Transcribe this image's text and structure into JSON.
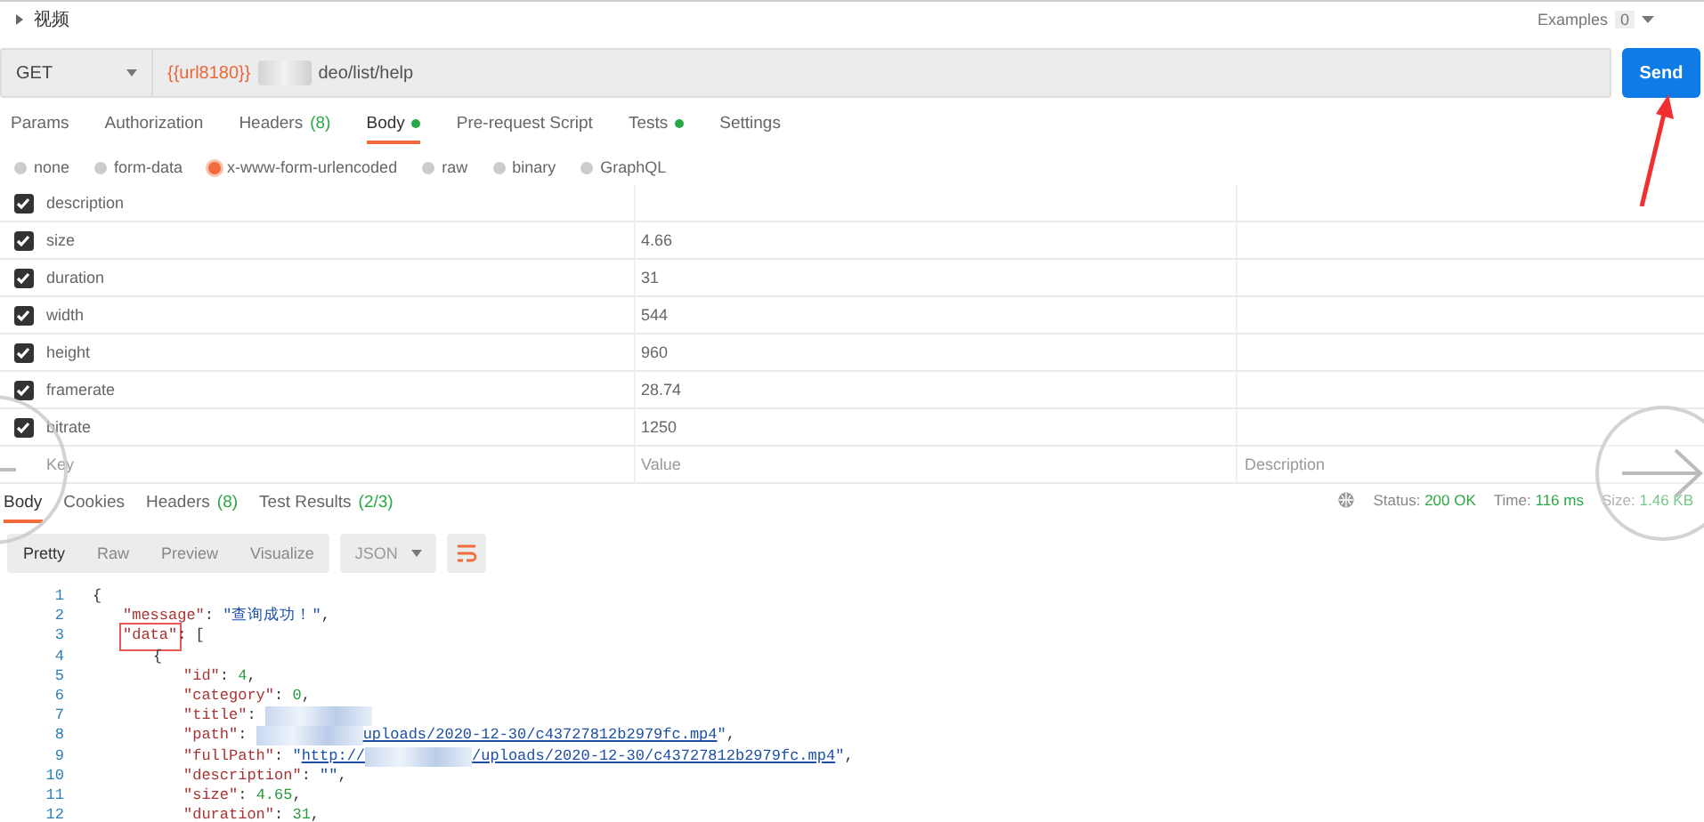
{
  "collection": {
    "label": "视频",
    "expanded": false
  },
  "examples": {
    "label": "Examples",
    "count": "0"
  },
  "request": {
    "method": "GET",
    "url_variable": "{{url8180}}",
    "url_path": "deo/list/help"
  },
  "send_button": "Send",
  "request_tabs": [
    {
      "label": "Params",
      "selected": false,
      "dot": false
    },
    {
      "label": "Authorization",
      "selected": false,
      "dot": false
    },
    {
      "label": "Headers",
      "count": "(8)",
      "selected": false,
      "dot": false
    },
    {
      "label": "Body",
      "selected": true,
      "dot": true
    },
    {
      "label": "Pre-request Script",
      "selected": false,
      "dot": false
    },
    {
      "label": "Tests",
      "selected": false,
      "dot": true
    },
    {
      "label": "Settings",
      "selected": false,
      "dot": false
    }
  ],
  "body_types": [
    {
      "label": "none",
      "selected": false
    },
    {
      "label": "form-data",
      "selected": false
    },
    {
      "label": "x-www-form-urlencoded",
      "selected": true
    },
    {
      "label": "raw",
      "selected": false
    },
    {
      "label": "binary",
      "selected": false
    },
    {
      "label": "GraphQL",
      "selected": false
    }
  ],
  "params": {
    "rows": [
      {
        "checked": true,
        "key": "description"
      },
      {
        "checked": true,
        "key": "size",
        "value": "4.66"
      },
      {
        "checked": true,
        "key": "duration",
        "value": "31"
      },
      {
        "checked": true,
        "key": "width",
        "value": "544"
      },
      {
        "checked": true,
        "key": "height",
        "value": "960"
      },
      {
        "checked": true,
        "key": "framerate",
        "value": "28.74"
      },
      {
        "checked": true,
        "key": "bitrate",
        "value": "1250"
      }
    ],
    "placeholders": {
      "key": "Key",
      "value": "Value",
      "description": "Description"
    }
  },
  "response_tabs": [
    {
      "label": "Body",
      "selected": true
    },
    {
      "label": "Cookies",
      "selected": false
    },
    {
      "label": "Headers",
      "count": "(8)",
      "selected": false
    },
    {
      "label": "Test Results",
      "count": "(2/3)",
      "selected": false
    }
  ],
  "response_meta": {
    "status_label": "Status:",
    "status": "200 OK",
    "time_label": "Time:",
    "time": "116 ms",
    "size_label": "Size:",
    "size": "1.46 KB"
  },
  "view_modes": [
    {
      "label": "Pretty",
      "selected": true
    },
    {
      "label": "Raw",
      "selected": false
    },
    {
      "label": "Preview",
      "selected": false
    },
    {
      "label": "Visualize",
      "selected": false
    }
  ],
  "format": "JSON",
  "code_lines": [
    {
      "number": "1",
      "tokens": [
        {
          "kind": "punct",
          "text": "{"
        }
      ]
    },
    {
      "number": "2",
      "tokens": [
        {
          "kind": "key",
          "text": "\"message\"",
          "boxed": false
        },
        {
          "kind": "punct",
          "text": ": "
        },
        {
          "kind": "string",
          "text": "\"查询成功！\""
        },
        {
          "kind": "punct",
          "text": ","
        }
      ]
    },
    {
      "number": "3",
      "tokens": [
        {
          "kind": "key",
          "text": "\"data\"",
          "boxed": true
        },
        {
          "kind": "punct",
          "text": ": ["
        }
      ]
    },
    {
      "number": "4",
      "tokens": [
        {
          "kind": "punct",
          "text": "{"
        }
      ]
    },
    {
      "number": "5",
      "tokens": [
        {
          "kind": "key",
          "text": "\"id\"",
          "boxed": false
        },
        {
          "kind": "punct",
          "text": ": "
        },
        {
          "kind": "number",
          "text": "4"
        },
        {
          "kind": "punct",
          "text": ","
        }
      ]
    },
    {
      "number": "6",
      "tokens": [
        {
          "kind": "key",
          "text": "\"category\"",
          "boxed": false
        },
        {
          "kind": "punct",
          "text": ": "
        },
        {
          "kind": "number",
          "text": "0"
        },
        {
          "kind": "punct",
          "text": ","
        }
      ]
    },
    {
      "number": "7",
      "tokens": [
        {
          "kind": "key",
          "text": "\"title\"",
          "boxed": false
        },
        {
          "kind": "punct",
          "text": ": "
        },
        {
          "kind": "redacted"
        }
      ]
    },
    {
      "number": "8",
      "tokens": [
        {
          "kind": "key",
          "text": "\"path\"",
          "boxed": false
        },
        {
          "kind": "punct",
          "text": ": "
        },
        {
          "kind": "redacted"
        },
        {
          "kind": "link",
          "text": "uploads/2020-12-30/c43727812b2979fc.mp4"
        },
        {
          "kind": "string",
          "text": "\""
        },
        {
          "kind": "punct",
          "text": ","
        }
      ]
    },
    {
      "number": "9",
      "tokens": [
        {
          "kind": "key",
          "text": "\"fullPath\"",
          "boxed": false
        },
        {
          "kind": "punct",
          "text": ": "
        },
        {
          "kind": "string",
          "text": "\""
        },
        {
          "kind": "link",
          "text": "http://"
        },
        {
          "kind": "redacted"
        },
        {
          "kind": "link",
          "text": "/uploads/2020-12-30/c43727812b2979fc.mp4"
        },
        {
          "kind": "string",
          "text": "\""
        },
        {
          "kind": "punct",
          "text": ","
        }
      ]
    },
    {
      "number": "10",
      "tokens": [
        {
          "kind": "key",
          "text": "\"description\"",
          "boxed": false
        },
        {
          "kind": "punct",
          "text": ": "
        },
        {
          "kind": "string",
          "text": "\"\""
        },
        {
          "kind": "punct",
          "text": ","
        }
      ]
    },
    {
      "number": "11",
      "tokens": [
        {
          "kind": "key",
          "text": "\"size\"",
          "boxed": false
        },
        {
          "kind": "punct",
          "text": ": "
        },
        {
          "kind": "number",
          "text": "4.65"
        },
        {
          "kind": "punct",
          "text": ","
        }
      ]
    },
    {
      "number": "12",
      "tokens": [
        {
          "kind": "key",
          "text": "\"duration\"",
          "boxed": false
        },
        {
          "kind": "punct",
          "text": ": "
        },
        {
          "kind": "number",
          "text": "31"
        },
        {
          "kind": "punct",
          "text": ","
        }
      ]
    }
  ]
}
